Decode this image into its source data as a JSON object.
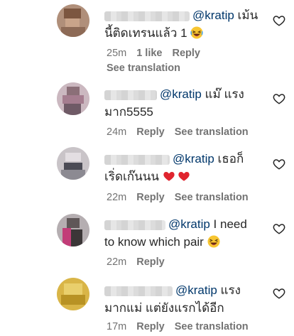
{
  "comments": [
    {
      "mention": "@kratip",
      "line1_after": " เม้น",
      "line2": "นี้ติดเทรนแล้ว 1 ",
      "emoji": "laugh",
      "time": "25m",
      "likes": "1 like",
      "reply": "Reply",
      "see_translation": "See translation"
    },
    {
      "mention": "@kratip",
      "line1_after": " แม๊ แรง",
      "line2": "มาก5555",
      "time": "24m",
      "reply": "Reply",
      "see_translation": "See translation"
    },
    {
      "mention": "@kratip",
      "line1_after": " เธอก็",
      "line2": "เริ่ดเก๊นนน ",
      "emoji": "hearts",
      "time": "22m",
      "reply": "Reply",
      "see_translation": "See translation"
    },
    {
      "mention": "@kratip",
      "line1_after": " I need",
      "line2": "to know which pair ",
      "emoji": "laugh",
      "time": "22m",
      "reply": "Reply"
    },
    {
      "mention": "@kratip",
      "line1_after": " แรง",
      "line2": "มากแม่ แต่ยังแรกได้อีก",
      "time": "17m",
      "reply": "Reply",
      "see_translation": "See translation"
    }
  ]
}
